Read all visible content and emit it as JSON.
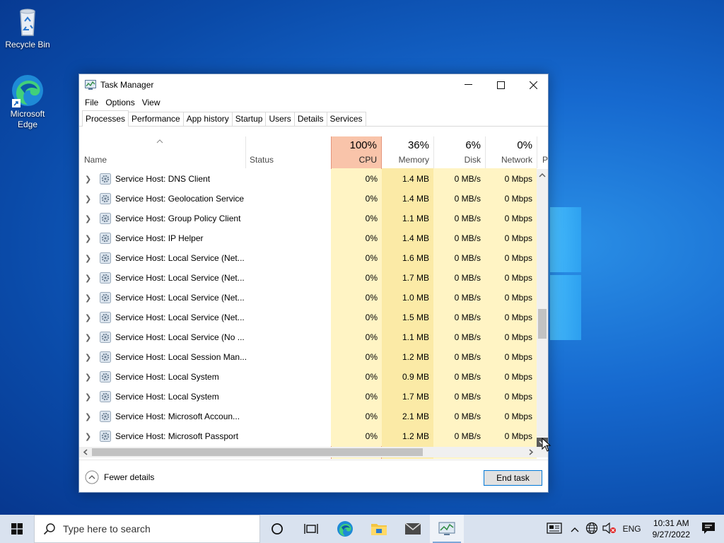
{
  "desktop": {
    "icons": [
      {
        "label": "Recycle Bin"
      },
      {
        "label": "Microsoft Edge"
      }
    ]
  },
  "window": {
    "title": "Task Manager",
    "menu": [
      "File",
      "Options",
      "View"
    ],
    "tabs": [
      "Processes",
      "Performance",
      "App history",
      "Startup",
      "Users",
      "Details",
      "Services"
    ],
    "active_tab": "Processes",
    "columns": {
      "name": "Name",
      "status": "Status",
      "cpu": {
        "pct": "100%",
        "label": "CPU"
      },
      "memory": {
        "pct": "36%",
        "label": "Memory"
      },
      "disk": {
        "pct": "6%",
        "label": "Disk"
      },
      "network": {
        "pct": "0%",
        "label": "Network"
      },
      "power_partial": "P"
    },
    "rows": [
      {
        "name": "Service Host: DNS Client",
        "cpu": "0%",
        "memory": "1.4 MB",
        "disk": "0 MB/s",
        "network": "0 Mbps"
      },
      {
        "name": "Service Host: Geolocation Service",
        "cpu": "0%",
        "memory": "1.4 MB",
        "disk": "0 MB/s",
        "network": "0 Mbps"
      },
      {
        "name": "Service Host: Group Policy Client",
        "cpu": "0%",
        "memory": "1.1 MB",
        "disk": "0 MB/s",
        "network": "0 Mbps"
      },
      {
        "name": "Service Host: IP Helper",
        "cpu": "0%",
        "memory": "1.4 MB",
        "disk": "0 MB/s",
        "network": "0 Mbps"
      },
      {
        "name": "Service Host: Local Service (Net...",
        "cpu": "0%",
        "memory": "1.6 MB",
        "disk": "0 MB/s",
        "network": "0 Mbps"
      },
      {
        "name": "Service Host: Local Service (Net...",
        "cpu": "0%",
        "memory": "1.7 MB",
        "disk": "0 MB/s",
        "network": "0 Mbps"
      },
      {
        "name": "Service Host: Local Service (Net...",
        "cpu": "0%",
        "memory": "1.0 MB",
        "disk": "0 MB/s",
        "network": "0 Mbps"
      },
      {
        "name": "Service Host: Local Service (Net...",
        "cpu": "0%",
        "memory": "1.5 MB",
        "disk": "0 MB/s",
        "network": "0 Mbps"
      },
      {
        "name": "Service Host: Local Service (No ...",
        "cpu": "0%",
        "memory": "1.1 MB",
        "disk": "0 MB/s",
        "network": "0 Mbps"
      },
      {
        "name": "Service Host: Local Session Man...",
        "cpu": "0%",
        "memory": "1.2 MB",
        "disk": "0 MB/s",
        "network": "0 Mbps"
      },
      {
        "name": "Service Host: Local System",
        "cpu": "0%",
        "memory": "0.9 MB",
        "disk": "0 MB/s",
        "network": "0 Mbps"
      },
      {
        "name": "Service Host: Local System",
        "cpu": "0%",
        "memory": "1.7 MB",
        "disk": "0 MB/s",
        "network": "0 Mbps"
      },
      {
        "name": "Service Host: Microsoft Accoun...",
        "cpu": "0%",
        "memory": "2.1 MB",
        "disk": "0 MB/s",
        "network": "0 Mbps"
      },
      {
        "name": "Service Host: Microsoft Passport",
        "cpu": "0%",
        "memory": "1.2 MB",
        "disk": "0 MB/s",
        "network": "0 Mbps"
      }
    ],
    "footer": {
      "fewer_details": "Fewer details",
      "end_task": "End task"
    }
  },
  "taskbar": {
    "search_placeholder": "Type here to search",
    "tray_lang": "ENG",
    "time": "10:31 AM",
    "date": "9/27/2022"
  },
  "colors": {
    "cpu_header_bg": "#f9c4aa",
    "cpu_cell_bg": "#fff4c4",
    "memory_cell_bg": "#fbeaa6",
    "accent": "#0078d7"
  }
}
